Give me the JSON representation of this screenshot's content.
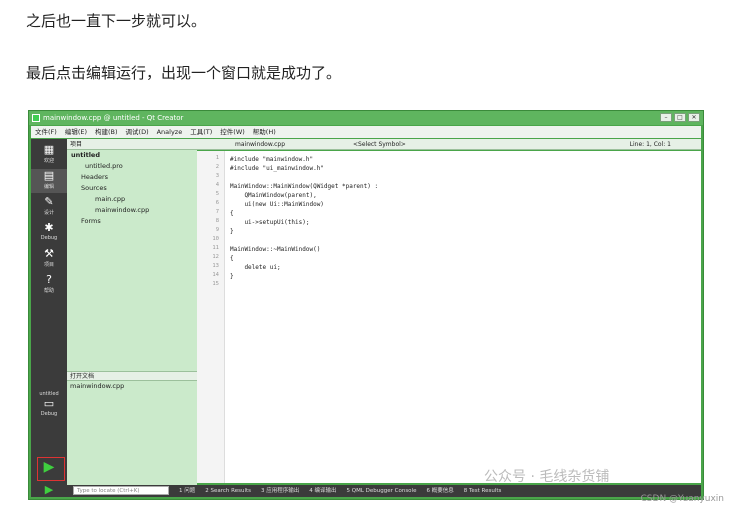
{
  "article": {
    "p1": "之后也一直下一步就可以。",
    "p2": "最后点击编辑运行，出现一个窗口就是成功了。"
  },
  "window": {
    "title": "mainwindow.cpp @ untitled - Qt Creator",
    "min": "–",
    "max": "□",
    "close": "✕"
  },
  "menu": [
    "文件(F)",
    "编辑(E)",
    "构建(B)",
    "调试(D)",
    "Analyze",
    "工具(T)",
    "控件(W)",
    "帮助(H)"
  ],
  "modes": [
    {
      "icon": "▦",
      "label": "欢迎"
    },
    {
      "icon": "▤",
      "label": "编辑"
    },
    {
      "icon": "✎",
      "label": "设计"
    },
    {
      "icon": "✱",
      "label": "Debug"
    },
    {
      "icon": "⚒",
      "label": "项目"
    },
    {
      "icon": "?",
      "label": "帮助"
    }
  ],
  "kit": {
    "project": "untitled",
    "label": "Debug"
  },
  "project": {
    "header": "项目",
    "tree": [
      "untitled",
      "untitled.pro",
      "Headers",
      "Sources",
      "main.cpp",
      "mainwindow.cpp",
      "Forms"
    ]
  },
  "open_docs": {
    "header": "打开文档",
    "items": [
      "mainwindow.cpp"
    ]
  },
  "editor": {
    "file": "mainwindow.cpp",
    "symbol": "<Select Symbol>",
    "position": "Line: 1, Col: 1"
  },
  "code": [
    "#include \"mainwindow.h\"",
    "#include \"ui_mainwindow.h\"",
    "",
    "MainWindow::MainWindow(QWidget *parent) :",
    "    QMainWindow(parent),",
    "    ui(new Ui::MainWindow)",
    "{",
    "    ui->setupUi(this);",
    "}",
    "",
    "MainWindow::~MainWindow()",
    "{",
    "    delete ui;",
    "}",
    ""
  ],
  "status": {
    "locate_placeholder": "Type to locate (Ctrl+K)",
    "tabs": [
      "1 问题",
      "2 Search Results",
      "3 应用程序输出",
      "4 编译输出",
      "5 QML Debugger Console",
      "6 概要信息",
      "8 Test Results"
    ]
  },
  "watermark": "公众号 · 毛线杂货铺",
  "credit": "CSDN @Yuanyuxin"
}
